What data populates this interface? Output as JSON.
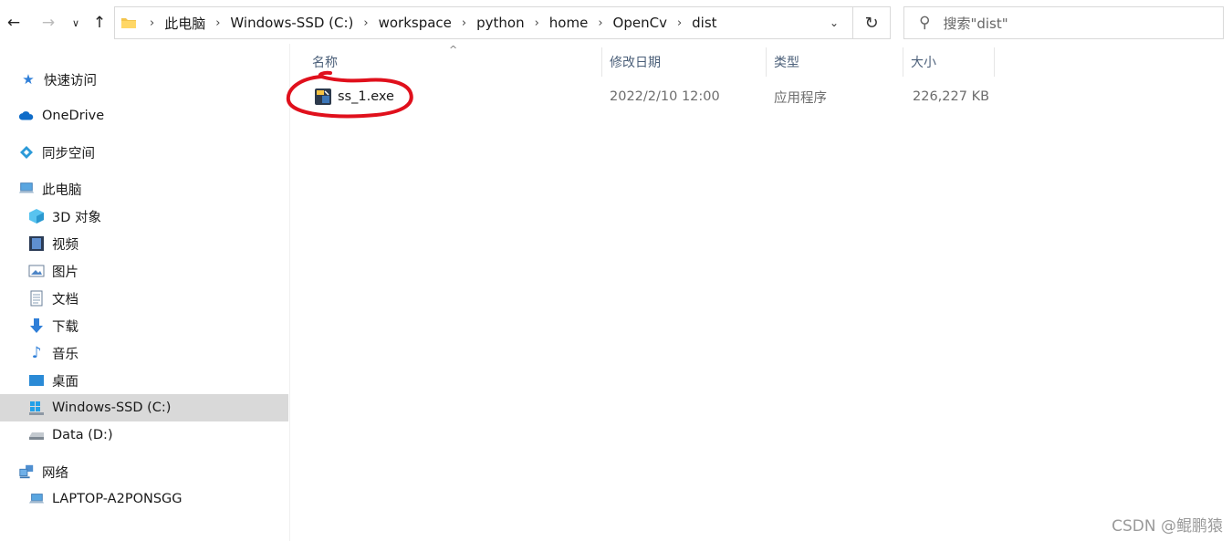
{
  "toolbar": {
    "back_icon": "arrow-left-icon",
    "forward_icon": "arrow-right-icon",
    "recent_icon": "chevron-down-icon",
    "up_icon": "arrow-up-icon"
  },
  "address": {
    "crumbs": [
      "此电脑",
      "Windows-SSD (C:)",
      "workspace",
      "python",
      "home",
      "OpenCv",
      "dist"
    ]
  },
  "search": {
    "placeholder": "搜索\"dist\""
  },
  "sidebar": {
    "quick_access": "快速访问",
    "onedrive": "OneDrive",
    "sync_space": "同步空间",
    "this_pc": "此电脑",
    "objects3d": "3D 对象",
    "videos": "视频",
    "pictures": "图片",
    "documents": "文档",
    "downloads": "下载",
    "music": "音乐",
    "desktop": "桌面",
    "drive_c": "Windows-SSD (C:)",
    "drive_d": "Data (D:)",
    "network": "网络",
    "laptop": "LAPTOP-A2PONSGG"
  },
  "columns": {
    "name": "名称",
    "date": "修改日期",
    "type": "类型",
    "size": "大小"
  },
  "files": [
    {
      "name": "ss_1.exe",
      "date": "2022/2/10 12:00",
      "type": "应用程序",
      "size": "226,227 KB"
    }
  ],
  "watermark": "CSDN @鲲鹏猿",
  "colors": {
    "selected": "#d9d9d9",
    "annotation": "#e0101c",
    "header_text": "#4c607a"
  }
}
